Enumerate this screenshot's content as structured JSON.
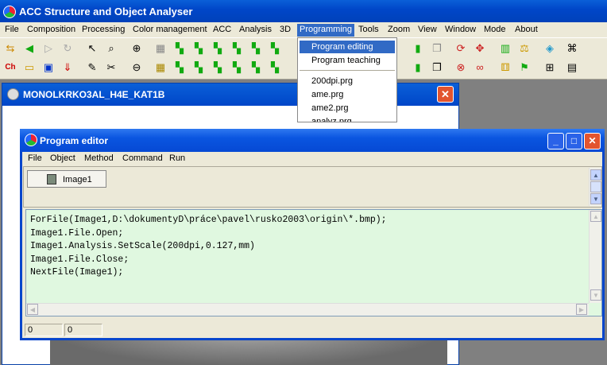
{
  "app": {
    "title": "ACC Structure and Object Analyser"
  },
  "menubar": [
    {
      "label": "File"
    },
    {
      "label": "Composition"
    },
    {
      "label": "Processing"
    },
    {
      "label": "Color management"
    },
    {
      "label": "ACC"
    },
    {
      "label": "Analysis"
    },
    {
      "label": "3D"
    },
    {
      "label": "Programming"
    },
    {
      "label": "Tools"
    },
    {
      "label": "Zoom"
    },
    {
      "label": "View"
    },
    {
      "label": "Window"
    },
    {
      "label": "Mode"
    },
    {
      "label": "About"
    }
  ],
  "programming_menu": {
    "items": [
      {
        "label": "Program editing"
      },
      {
        "label": "Program teaching"
      },
      {
        "label": "200dpi.prg"
      },
      {
        "label": "ame.prg"
      },
      {
        "label": "ame2.prg"
      },
      {
        "label": "analyz.prg"
      }
    ]
  },
  "image_window": {
    "title": "MONOLKRKO3AL_H4E_KAT1B",
    "close_label": "✕"
  },
  "editor": {
    "title": "Program editor",
    "menu": [
      {
        "label": "File"
      },
      {
        "label": "Object"
      },
      {
        "label": "Method"
      },
      {
        "label": "Command"
      },
      {
        "label": "Run"
      }
    ],
    "object_tab": "Image1",
    "code": "ForFile(Image1,D:\\dokumentyD\\práce\\pavel\\rusko2003\\origin\\*.bmp);\nImage1.File.Open;\nImage1.Analysis.SetScale(200dpi,0.127,mm)\nImage1.File.Close;\nNextFile(Image1);",
    "status": [
      "0",
      "0"
    ],
    "buttons": {
      "minimize": "_",
      "maximize": "□",
      "close": "✕"
    }
  },
  "colors": {
    "titlebar": "#0046c8",
    "menu_highlight": "#316ac5",
    "code_background": "#e0f8e0"
  }
}
